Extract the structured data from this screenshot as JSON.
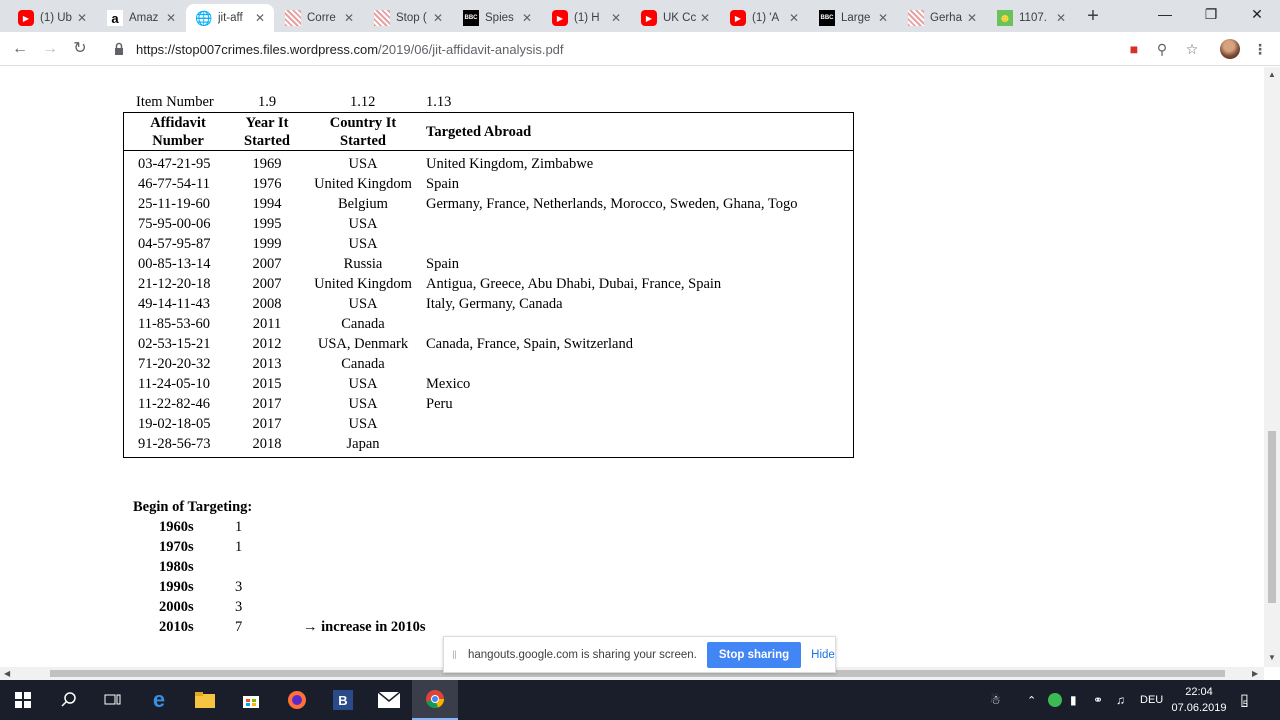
{
  "browser": {
    "tabs": [
      {
        "title": "(1) Üb",
        "icon": "youtube-icon"
      },
      {
        "title": "Amaz",
        "icon": "amazon-icon"
      },
      {
        "title": "jit-aff",
        "icon": "globe-icon",
        "active": true
      },
      {
        "title": "Corre",
        "icon": "wordpress-icon"
      },
      {
        "title": "Stop (",
        "icon": "wordpress-icon"
      },
      {
        "title": "Spies",
        "icon": "bbc-icon"
      },
      {
        "title": "(1) H",
        "icon": "youtube-icon"
      },
      {
        "title": "UK Cc",
        "icon": "youtube-icon"
      },
      {
        "title": "(1) 'A",
        "icon": "youtube-icon"
      },
      {
        "title": "Large",
        "icon": "bbc-icon"
      },
      {
        "title": "Gerha",
        "icon": "wordpress-icon"
      },
      {
        "title": "1107.",
        "icon": "smiley-icon"
      }
    ],
    "url_host": "https://stop007crimes.files.wordpress.com",
    "url_path": "/2019/06/jit-affidavit-analysis.pdf"
  },
  "document": {
    "item_label": "Item Number",
    "item_numbers": [
      "1.9",
      "1.12",
      "1.13"
    ],
    "headers": {
      "affidavit": [
        "Affidavit",
        "Number"
      ],
      "year": [
        "Year It",
        "Started"
      ],
      "country": [
        "Country It",
        "Started"
      ],
      "targeted": "Targeted Abroad"
    },
    "rows": [
      {
        "aff": "03-47-21-95",
        "year": "1969",
        "country": "USA",
        "targeted": "United Kingdom, Zimbabwe"
      },
      {
        "aff": "46-77-54-11",
        "year": "1976",
        "country": "United Kingdom",
        "targeted": "Spain"
      },
      {
        "aff": "25-11-19-60",
        "year": "1994",
        "country": "Belgium",
        "targeted": "Germany, France, Netherlands, Morocco, Sweden, Ghana, Togo"
      },
      {
        "aff": "75-95-00-06",
        "year": "1995",
        "country": "USA",
        "targeted": ""
      },
      {
        "aff": "04-57-95-87",
        "year": "1999",
        "country": "USA",
        "targeted": ""
      },
      {
        "aff": "00-85-13-14",
        "year": "2007",
        "country": "Russia",
        "targeted": "Spain"
      },
      {
        "aff": "21-12-20-18",
        "year": "2007",
        "country": "United Kingdom",
        "targeted": "Antigua, Greece, Abu Dhabi, Dubai, France, Spain"
      },
      {
        "aff": "49-14-11-43",
        "year": "2008",
        "country": "USA",
        "targeted": "Italy, Germany, Canada"
      },
      {
        "aff": "11-85-53-60",
        "year": "2011",
        "country": "Canada",
        "targeted": ""
      },
      {
        "aff": "02-53-15-21",
        "year": "2012",
        "country": "USA, Denmark",
        "targeted": "Canada, France, Spain, Switzerland"
      },
      {
        "aff": "71-20-20-32",
        "year": "2013",
        "country": "Canada",
        "targeted": ""
      },
      {
        "aff": "11-24-05-10",
        "year": "2015",
        "country": "USA",
        "targeted": "Mexico"
      },
      {
        "aff": "11-22-82-46",
        "year": "2017",
        "country": "USA",
        "targeted": "Peru"
      },
      {
        "aff": "19-02-18-05",
        "year": "2017",
        "country": "USA",
        "targeted": ""
      },
      {
        "aff": "91-28-56-73",
        "year": "2018",
        "country": "Japan",
        "targeted": ""
      }
    ],
    "begin_title": "Begin of Targeting:",
    "decades": [
      {
        "label": "1960s",
        "value": "1"
      },
      {
        "label": "1970s",
        "value": "1"
      },
      {
        "label": "1980s",
        "value": ""
      },
      {
        "label": "1990s",
        "value": "3"
      },
      {
        "label": "2000s",
        "value": "3"
      },
      {
        "label": "2010s",
        "value": "7"
      }
    ],
    "increase_note": "→ increase in 2010s"
  },
  "sharebar": {
    "message": "hangouts.google.com is sharing your screen.",
    "stop_label": "Stop sharing",
    "hide_label": "Hide"
  },
  "taskbar": {
    "language": "DEU",
    "time": "22:04",
    "date": "07.06.2019",
    "notification_count": "5"
  }
}
